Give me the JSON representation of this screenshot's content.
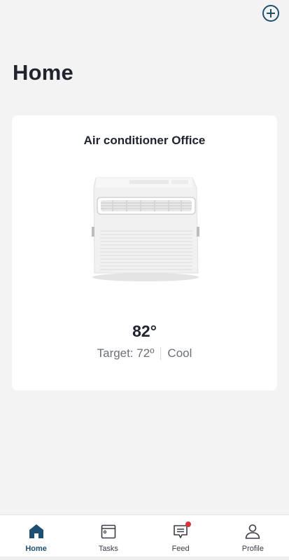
{
  "header": {
    "title": "Home",
    "add_icon": "plus-circle-icon",
    "accent_color": "#1d4f73"
  },
  "device_card": {
    "name": "Air conditioner Office",
    "current_temp": "82°",
    "target_label": "Target: 72º",
    "mode": "Cool",
    "image": "air-conditioner-unit"
  },
  "tab_bar": {
    "tabs": [
      {
        "label": "Home",
        "icon": "home-icon",
        "active": true
      },
      {
        "label": "Tasks",
        "icon": "tasks-icon",
        "active": false
      },
      {
        "label": "Feed",
        "icon": "feed-icon",
        "active": false,
        "badge": true
      },
      {
        "label": "Profile",
        "icon": "profile-icon",
        "active": false
      }
    ],
    "badge_color": "#d3353a"
  }
}
